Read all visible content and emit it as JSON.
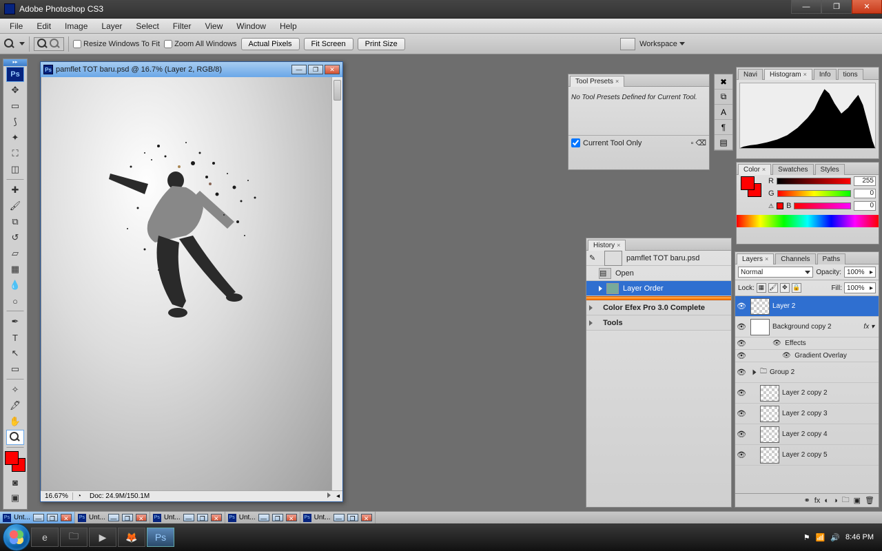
{
  "window": {
    "title": "Adobe Photoshop CS3"
  },
  "menu": [
    "File",
    "Edit",
    "Image",
    "Layer",
    "Select",
    "Filter",
    "View",
    "Window",
    "Help"
  ],
  "options": {
    "resize": "Resize Windows To Fit",
    "zoomall": "Zoom All Windows",
    "actual": "Actual Pixels",
    "fit": "Fit Screen",
    "print": "Print Size",
    "workspace": "Workspace"
  },
  "doc": {
    "title": "pamflet TOT baru.psd @ 16.7% (Layer 2, RGB/8)",
    "zoom": "16.67%",
    "docsize": "Doc: 24.9M/150.1M"
  },
  "toolpresets": {
    "tab": "Tool Presets",
    "msg": "No Tool Presets Defined for Current Tool.",
    "footer": "Current Tool Only"
  },
  "histo": {
    "tabs": [
      "Navi",
      "Histogram",
      "Info",
      "tions"
    ]
  },
  "color": {
    "tabs": [
      "Color",
      "Swatches",
      "Styles"
    ],
    "r": {
      "label": "R",
      "val": "255"
    },
    "g": {
      "label": "G",
      "val": "0"
    },
    "b": {
      "label": "B",
      "val": "0"
    }
  },
  "history": {
    "tab": "History",
    "file": "pamflet TOT baru.psd",
    "items": [
      {
        "label": "Open"
      },
      {
        "label": "Layer Order",
        "sel": true
      }
    ],
    "groups": [
      "Color Efex Pro 3.0 Complete",
      "Tools"
    ]
  },
  "layers": {
    "tabs": [
      "Layers",
      "Channels",
      "Paths"
    ],
    "mode": "Normal",
    "opacityL": "Opacity:",
    "opacity": "100%",
    "lock": "Lock:",
    "fillL": "Fill:",
    "fill": "100%",
    "items": [
      {
        "name": "Layer 2",
        "sel": true,
        "trans": true
      },
      {
        "name": "Background copy 2",
        "fx": "fx"
      },
      {
        "name": "Effects",
        "indent": 1,
        "eff": true
      },
      {
        "name": "Gradient Overlay",
        "indent": 2,
        "eff": true
      },
      {
        "name": "Group 2",
        "group": true
      },
      {
        "name": "Layer 2 copy 2",
        "trans": true,
        "indent": 1
      },
      {
        "name": "Layer 2 copy 3",
        "trans": true,
        "indent": 1
      },
      {
        "name": "Layer 2 copy 4",
        "trans": true,
        "indent": 1
      },
      {
        "name": "Layer 2 copy 5",
        "trans": true,
        "indent": 1
      }
    ]
  },
  "doctabs": [
    {
      "label": "Unt...",
      "cur": true
    },
    {
      "label": "Unt..."
    },
    {
      "label": "Unt..."
    },
    {
      "label": "Unt..."
    },
    {
      "label": "Unt..."
    }
  ],
  "tray": {
    "time": "8:46 PM"
  }
}
